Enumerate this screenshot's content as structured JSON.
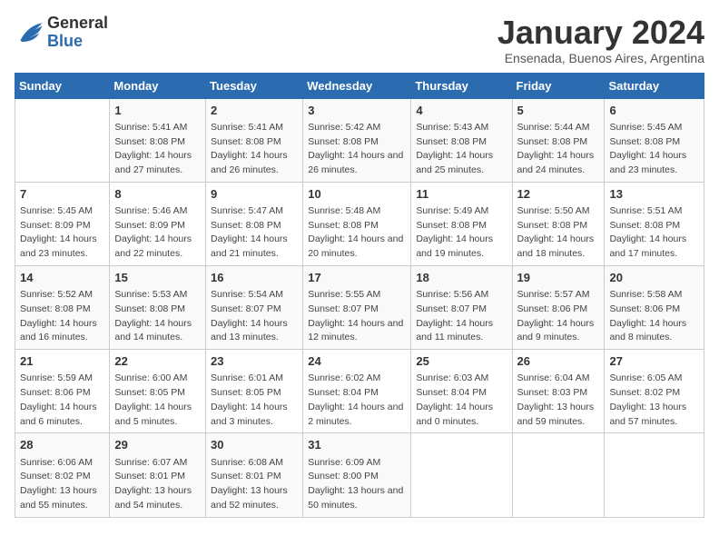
{
  "logo": {
    "general": "General",
    "blue": "Blue"
  },
  "title": "January 2024",
  "subtitle": "Ensenada, Buenos Aires, Argentina",
  "days_of_week": [
    "Sunday",
    "Monday",
    "Tuesday",
    "Wednesday",
    "Thursday",
    "Friday",
    "Saturday"
  ],
  "weeks": [
    [
      {
        "day": null
      },
      {
        "day": "1",
        "sunrise": "Sunrise: 5:41 AM",
        "sunset": "Sunset: 8:08 PM",
        "daylight": "Daylight: 14 hours and 27 minutes."
      },
      {
        "day": "2",
        "sunrise": "Sunrise: 5:41 AM",
        "sunset": "Sunset: 8:08 PM",
        "daylight": "Daylight: 14 hours and 26 minutes."
      },
      {
        "day": "3",
        "sunrise": "Sunrise: 5:42 AM",
        "sunset": "Sunset: 8:08 PM",
        "daylight": "Daylight: 14 hours and 26 minutes."
      },
      {
        "day": "4",
        "sunrise": "Sunrise: 5:43 AM",
        "sunset": "Sunset: 8:08 PM",
        "daylight": "Daylight: 14 hours and 25 minutes."
      },
      {
        "day": "5",
        "sunrise": "Sunrise: 5:44 AM",
        "sunset": "Sunset: 8:08 PM",
        "daylight": "Daylight: 14 hours and 24 minutes."
      },
      {
        "day": "6",
        "sunrise": "Sunrise: 5:45 AM",
        "sunset": "Sunset: 8:08 PM",
        "daylight": "Daylight: 14 hours and 23 minutes."
      }
    ],
    [
      {
        "day": "7",
        "sunrise": "Sunrise: 5:45 AM",
        "sunset": "Sunset: 8:09 PM",
        "daylight": "Daylight: 14 hours and 23 minutes."
      },
      {
        "day": "8",
        "sunrise": "Sunrise: 5:46 AM",
        "sunset": "Sunset: 8:09 PM",
        "daylight": "Daylight: 14 hours and 22 minutes."
      },
      {
        "day": "9",
        "sunrise": "Sunrise: 5:47 AM",
        "sunset": "Sunset: 8:08 PM",
        "daylight": "Daylight: 14 hours and 21 minutes."
      },
      {
        "day": "10",
        "sunrise": "Sunrise: 5:48 AM",
        "sunset": "Sunset: 8:08 PM",
        "daylight": "Daylight: 14 hours and 20 minutes."
      },
      {
        "day": "11",
        "sunrise": "Sunrise: 5:49 AM",
        "sunset": "Sunset: 8:08 PM",
        "daylight": "Daylight: 14 hours and 19 minutes."
      },
      {
        "day": "12",
        "sunrise": "Sunrise: 5:50 AM",
        "sunset": "Sunset: 8:08 PM",
        "daylight": "Daylight: 14 hours and 18 minutes."
      },
      {
        "day": "13",
        "sunrise": "Sunrise: 5:51 AM",
        "sunset": "Sunset: 8:08 PM",
        "daylight": "Daylight: 14 hours and 17 minutes."
      }
    ],
    [
      {
        "day": "14",
        "sunrise": "Sunrise: 5:52 AM",
        "sunset": "Sunset: 8:08 PM",
        "daylight": "Daylight: 14 hours and 16 minutes."
      },
      {
        "day": "15",
        "sunrise": "Sunrise: 5:53 AM",
        "sunset": "Sunset: 8:08 PM",
        "daylight": "Daylight: 14 hours and 14 minutes."
      },
      {
        "day": "16",
        "sunrise": "Sunrise: 5:54 AM",
        "sunset": "Sunset: 8:07 PM",
        "daylight": "Daylight: 14 hours and 13 minutes."
      },
      {
        "day": "17",
        "sunrise": "Sunrise: 5:55 AM",
        "sunset": "Sunset: 8:07 PM",
        "daylight": "Daylight: 14 hours and 12 minutes."
      },
      {
        "day": "18",
        "sunrise": "Sunrise: 5:56 AM",
        "sunset": "Sunset: 8:07 PM",
        "daylight": "Daylight: 14 hours and 11 minutes."
      },
      {
        "day": "19",
        "sunrise": "Sunrise: 5:57 AM",
        "sunset": "Sunset: 8:06 PM",
        "daylight": "Daylight: 14 hours and 9 minutes."
      },
      {
        "day": "20",
        "sunrise": "Sunrise: 5:58 AM",
        "sunset": "Sunset: 8:06 PM",
        "daylight": "Daylight: 14 hours and 8 minutes."
      }
    ],
    [
      {
        "day": "21",
        "sunrise": "Sunrise: 5:59 AM",
        "sunset": "Sunset: 8:06 PM",
        "daylight": "Daylight: 14 hours and 6 minutes."
      },
      {
        "day": "22",
        "sunrise": "Sunrise: 6:00 AM",
        "sunset": "Sunset: 8:05 PM",
        "daylight": "Daylight: 14 hours and 5 minutes."
      },
      {
        "day": "23",
        "sunrise": "Sunrise: 6:01 AM",
        "sunset": "Sunset: 8:05 PM",
        "daylight": "Daylight: 14 hours and 3 minutes."
      },
      {
        "day": "24",
        "sunrise": "Sunrise: 6:02 AM",
        "sunset": "Sunset: 8:04 PM",
        "daylight": "Daylight: 14 hours and 2 minutes."
      },
      {
        "day": "25",
        "sunrise": "Sunrise: 6:03 AM",
        "sunset": "Sunset: 8:04 PM",
        "daylight": "Daylight: 14 hours and 0 minutes."
      },
      {
        "day": "26",
        "sunrise": "Sunrise: 6:04 AM",
        "sunset": "Sunset: 8:03 PM",
        "daylight": "Daylight: 13 hours and 59 minutes."
      },
      {
        "day": "27",
        "sunrise": "Sunrise: 6:05 AM",
        "sunset": "Sunset: 8:02 PM",
        "daylight": "Daylight: 13 hours and 57 minutes."
      }
    ],
    [
      {
        "day": "28",
        "sunrise": "Sunrise: 6:06 AM",
        "sunset": "Sunset: 8:02 PM",
        "daylight": "Daylight: 13 hours and 55 minutes."
      },
      {
        "day": "29",
        "sunrise": "Sunrise: 6:07 AM",
        "sunset": "Sunset: 8:01 PM",
        "daylight": "Daylight: 13 hours and 54 minutes."
      },
      {
        "day": "30",
        "sunrise": "Sunrise: 6:08 AM",
        "sunset": "Sunset: 8:01 PM",
        "daylight": "Daylight: 13 hours and 52 minutes."
      },
      {
        "day": "31",
        "sunrise": "Sunrise: 6:09 AM",
        "sunset": "Sunset: 8:00 PM",
        "daylight": "Daylight: 13 hours and 50 minutes."
      },
      {
        "day": null
      },
      {
        "day": null
      },
      {
        "day": null
      }
    ]
  ]
}
